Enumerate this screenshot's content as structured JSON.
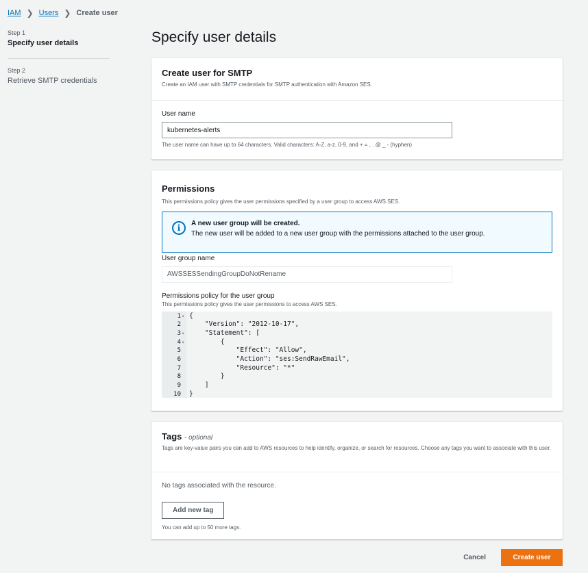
{
  "breadcrumb": {
    "root": "IAM",
    "users": "Users",
    "current": "Create user"
  },
  "steps": [
    {
      "num": "Step 1",
      "title": "Specify user details"
    },
    {
      "num": "Step 2",
      "title": "Retrieve SMTP credentials"
    }
  ],
  "page_title": "Specify user details",
  "smtp_panel": {
    "title": "Create user for SMTP",
    "description": "Create an IAM user with SMTP credentials for SMTP authentication with Amazon SES.",
    "user_name_label": "User name",
    "user_name_value": "kubernetes-alerts",
    "user_name_constraint": "The user name can have up to 64 characters. Valid characters: A-Z, a-z, 0-9, and + = , . @ _ - (hyphen)"
  },
  "permissions_panel": {
    "title": "Permissions",
    "description": "This permissions policy gives the user permissions specified by a user group to access AWS SES.",
    "info_icon": "info-icon",
    "info_title": "A new user group will be created.",
    "info_text": "The new user will be added to a new user group with the permissions attached to the user group.",
    "group_label": "User group name",
    "group_value": "AWSSESSendingGroupDoNotRename",
    "policy_label": "Permissions policy for the user group",
    "policy_desc": "This permissions policy gives the user permissions to access AWS SES.",
    "policy_lines": [
      {
        "n": "1",
        "text": "{"
      },
      {
        "n": "2",
        "text": "    \"Version\": \"2012-10-17\","
      },
      {
        "n": "3",
        "text": "    \"Statement\": ["
      },
      {
        "n": "4",
        "text": "        {"
      },
      {
        "n": "5",
        "text": "            \"Effect\": \"Allow\","
      },
      {
        "n": "6",
        "text": "            \"Action\": \"ses:SendRawEmail\","
      },
      {
        "n": "7",
        "text": "            \"Resource\": \"*\""
      },
      {
        "n": "8",
        "text": "        }"
      },
      {
        "n": "9",
        "text": "    ]"
      },
      {
        "n": "10",
        "text": "}"
      }
    ]
  },
  "tags_panel": {
    "title": "Tags",
    "optional": "- optional",
    "description": "Tags are key-value pairs you can add to AWS resources to help identify, organize, or search for resources. Choose any tags you want to associate with this user.",
    "empty_text": "No tags associated with the resource.",
    "add_button": "Add new tag",
    "limit_text": "You can add up to 50 more tags."
  },
  "footer": {
    "cancel": "Cancel",
    "create": "Create user"
  },
  "colors": {
    "primary": "#ec7211",
    "link": "#0073bb",
    "info_bg": "#f1faff"
  }
}
